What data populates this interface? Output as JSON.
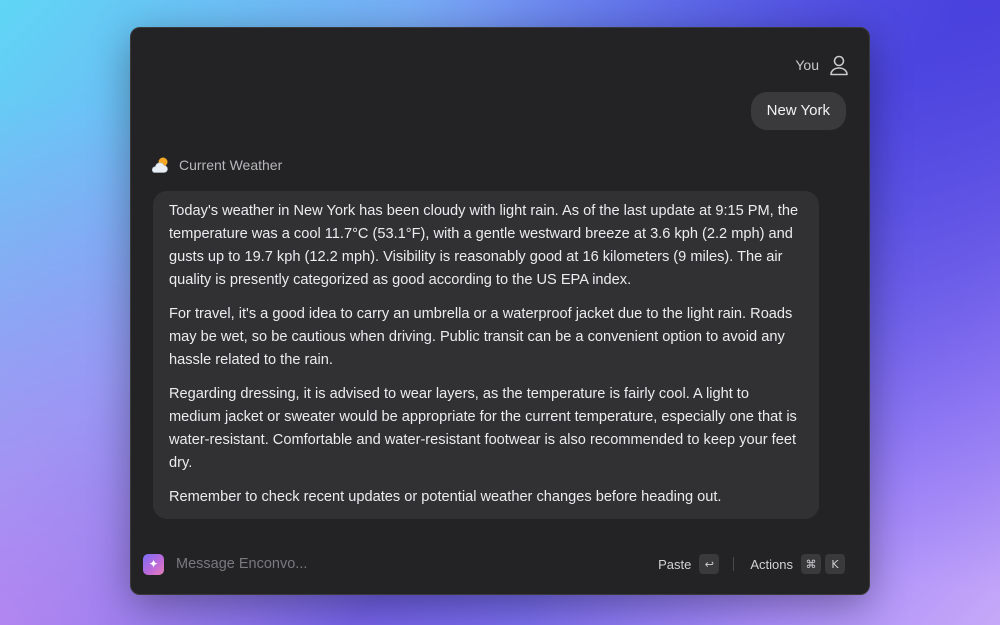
{
  "user": {
    "name": "You",
    "icon": "person-icon",
    "message": "New York"
  },
  "assistant": {
    "tool_label": "Current Weather",
    "tool_icon": "partly-cloudy-icon",
    "paragraphs": [
      "Today's weather in New York has been cloudy with light rain. As of the last update at 9:15 PM, the temperature was a cool 11.7°C (53.1°F), with a gentle westward breeze at 3.6 kph (2.2 mph) and gusts up to 19.7 kph (12.2 mph). Visibility is reasonably good at 16 kilometers (9 miles). The air quality is presently categorized as good according to the US EPA index.",
      "For travel, it's a good idea to carry an umbrella or a waterproof jacket due to the light rain. Roads may be wet, so be cautious when driving. Public transit can be a convenient option to avoid any hassle related to the rain.",
      "Regarding dressing, it is advised to wear layers, as the temperature is fairly cool. A light to medium jacket or sweater would be appropriate for the current temperature, especially one that is water-resistant. Comfortable and water-resistant footwear is also recommended to keep your feet dry.",
      "Remember to check recent updates or potential weather changes before heading out."
    ]
  },
  "composer": {
    "placeholder": "Message Enconvo...",
    "paste_label": "Paste",
    "paste_key": "↩",
    "actions_label": "Actions",
    "actions_keys": [
      "⌘",
      "K"
    ]
  }
}
